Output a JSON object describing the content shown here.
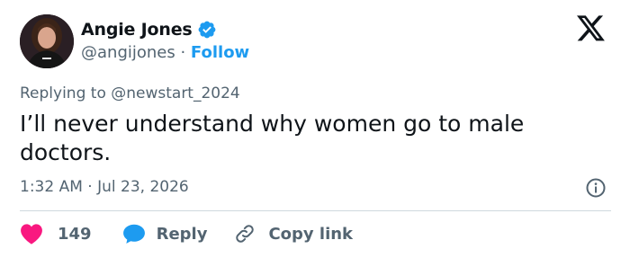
{
  "author": {
    "display_name": "Angie Jones",
    "handle": "@angijones",
    "separator": " · ",
    "follow_label": "Follow",
    "verified": true
  },
  "reply_context": "Replying to @newstart_2024",
  "tweet": {
    "text": "I’ll never understand why women go to male doctors.",
    "timestamp": "1:32 AM · Jul 23, 2026"
  },
  "actions": {
    "like_count": "149",
    "reply_label": "Reply",
    "copy_link_label": "Copy link"
  },
  "icons": {
    "logo": "x-logo-icon",
    "verified": "verified-badge-icon",
    "info": "info-icon",
    "like": "heart-icon",
    "reply": "speech-bubble-icon",
    "copy": "link-icon"
  },
  "colors": {
    "text": "#0f1419",
    "secondary": "#536471",
    "link": "#1d9bf0",
    "like": "#f91880",
    "divider": "#cfd9de"
  }
}
